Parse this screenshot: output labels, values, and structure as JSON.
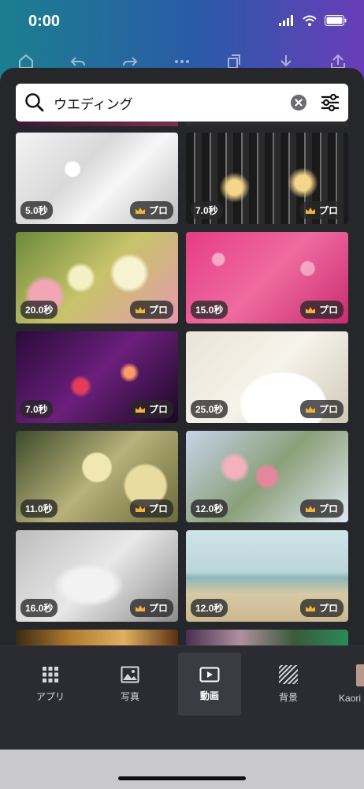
{
  "status_bar": {
    "time": "0:00"
  },
  "search": {
    "value": "ウエディング",
    "placeholder": ""
  },
  "tiles": [
    {
      "duration": "5.0秒",
      "badge": "プロ",
      "scene": "rings-on-lace"
    },
    {
      "duration": "7.0秒",
      "badge": "プロ",
      "scene": "crystal-chandelier"
    },
    {
      "duration": "20.0秒",
      "badge": "プロ",
      "scene": "rose-bouquet"
    },
    {
      "duration": "15.0秒",
      "badge": "プロ",
      "scene": "pink-hearts"
    },
    {
      "duration": "7.0秒",
      "badge": "プロ",
      "scene": "candle-table"
    },
    {
      "duration": "25.0秒",
      "badge": "プロ",
      "scene": "wedding-cake"
    },
    {
      "duration": "11.0秒",
      "badge": "プロ",
      "scene": "cream-puffs"
    },
    {
      "duration": "12.0秒",
      "badge": "プロ",
      "scene": "pink-rose-bouquet"
    },
    {
      "duration": "16.0秒",
      "badge": "プロ",
      "scene": "hanging-dress"
    },
    {
      "duration": "12.0秒",
      "badge": "プロ",
      "scene": "beach-couple"
    }
  ],
  "tabs": [
    {
      "label": "アプリ",
      "icon": "apps-grid-icon"
    },
    {
      "label": "写真",
      "icon": "photo-icon"
    },
    {
      "label": "動画",
      "icon": "video-icon",
      "active": true
    },
    {
      "label": "背景",
      "icon": "background-stripes-icon"
    },
    {
      "label": "Kaori",
      "icon": "folder-thumbnail"
    }
  ],
  "colors": {
    "sheet": "#26272b",
    "tabbar": "#2b2c31",
    "active_tab": "#3b3c42",
    "crown": "#f3b23c"
  }
}
